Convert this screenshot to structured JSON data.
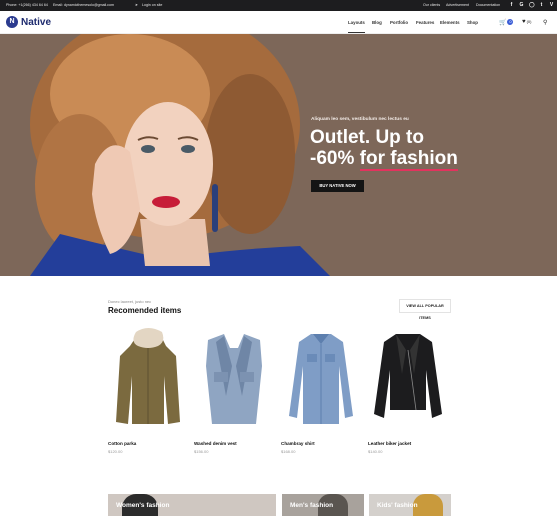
{
  "topbar": {
    "phone": "Phone: +1(266) 434 64 64",
    "email": "Email: dynamicthemesolo@gmail.com",
    "login": "Login on site",
    "links": [
      "Our clients",
      "Advertisement",
      "Documentation"
    ],
    "social_icons": [
      "facebook-icon",
      "google-icon",
      "instagram-icon",
      "twitter-icon",
      "vimeo-icon"
    ]
  },
  "header": {
    "logo": "Native",
    "nav": [
      "Layouts",
      "Blog",
      "Portfolio",
      "Features",
      "Elements",
      "Shop"
    ],
    "cart_count": "0",
    "wishlist_count": "(0)"
  },
  "hero": {
    "kicker": "Aliquam leo sem, vestibulum nec lectus eu",
    "title_line1": "Outlet. Up to",
    "title_line2_prefix": "-60% ",
    "title_line2_highlight": "for fashion",
    "button": "BUY NATIVE NOW",
    "bg_color": "#7d6759"
  },
  "recommended": {
    "kicker": "Donec laoreet, justo nec",
    "title": "Recomended items",
    "button": "VIEW ALL POPULAR ITEMS",
    "products": [
      {
        "name": "Cotton parka",
        "price": "$120.00"
      },
      {
        "name": "Washed denim vest",
        "price": "$156.00"
      },
      {
        "name": "Chambray shirt",
        "price": "$168.00"
      },
      {
        "name": "Leather biker jacket",
        "price": "$140.00"
      }
    ]
  },
  "banners": [
    "Women's fashion",
    "Men's fashion",
    "Kids' fashion"
  ],
  "colors": {
    "accent": "#e2335e",
    "brand": "#2b3b8f",
    "badge": "#3a5dd6"
  }
}
